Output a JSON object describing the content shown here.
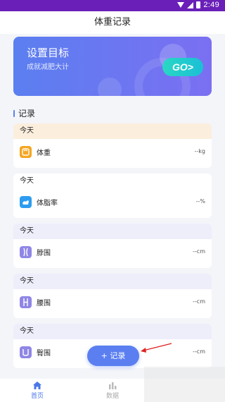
{
  "status_bar": {
    "time": "2:49"
  },
  "app_bar": {
    "title": "体重记录"
  },
  "banner": {
    "title": "设置目标",
    "subtitle": "成就减肥大计",
    "go_label": "GO>"
  },
  "section": {
    "title": "记录"
  },
  "records": [
    {
      "date": "今天",
      "name": "体重",
      "value": "--kg",
      "icon": "scale-icon",
      "color": "#f5a623",
      "header_bg": "#fbeedd"
    },
    {
      "date": "今天",
      "name": "体脂率",
      "value": "--%",
      "icon": "body-fat-icon",
      "color": "#2d9cf0",
      "header_bg": "#ffffff"
    },
    {
      "date": "今天",
      "name": "脖围",
      "value": "--cm",
      "icon": "neck-icon",
      "color": "#8f86e6",
      "header_bg": "#eeeefb"
    },
    {
      "date": "今天",
      "name": "腰围",
      "value": "--cm",
      "icon": "waist-icon",
      "color": "#8f86e6",
      "header_bg": "#eeeefb"
    },
    {
      "date": "今天",
      "name": "臀围",
      "value": "--cm",
      "icon": "hip-icon",
      "color": "#8f86e6",
      "header_bg": "#eeeefb"
    }
  ],
  "fab": {
    "label": "+ 记录"
  },
  "tabs": [
    {
      "label": "首页",
      "icon": "home-icon",
      "active": true
    },
    {
      "label": "数据",
      "icon": "bar-chart-icon",
      "active": false
    }
  ],
  "colors": {
    "accent": "#5b7ff0",
    "status_bar": "#6a1fb8",
    "go_button": "#2ad7c4"
  }
}
